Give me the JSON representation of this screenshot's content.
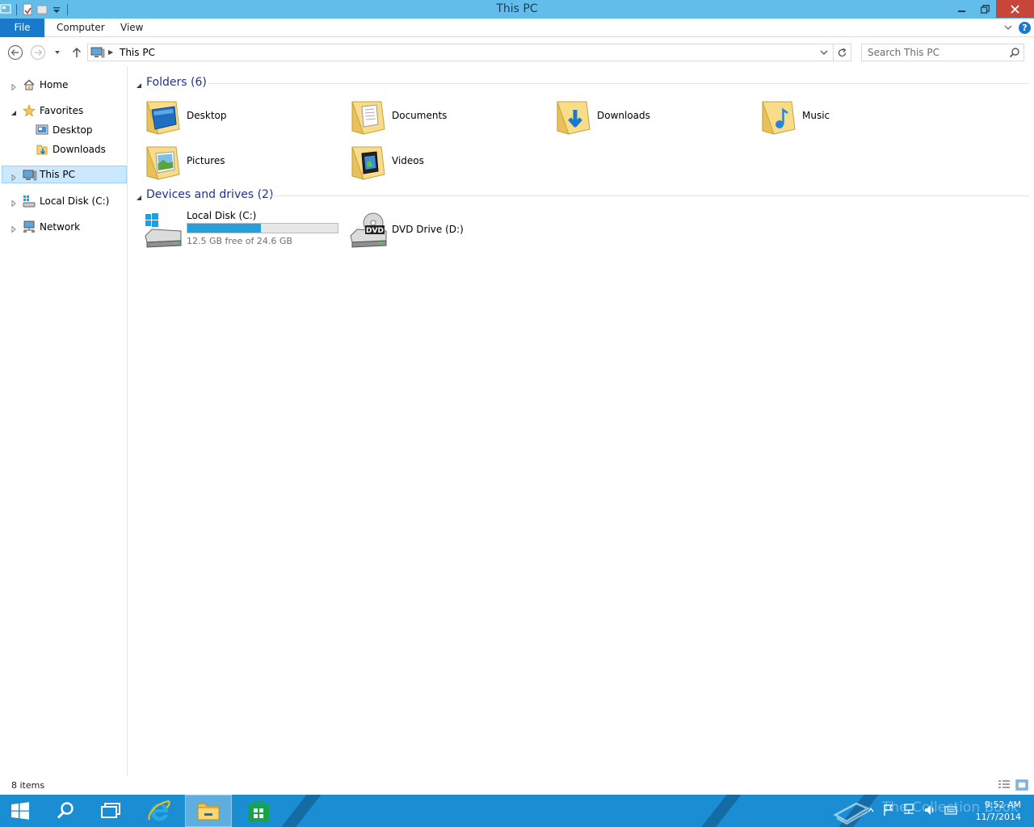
{
  "window": {
    "title": "This PC"
  },
  "ribbon": {
    "tabs": [
      "File",
      "Computer",
      "View"
    ]
  },
  "address": {
    "crumb": "This PC",
    "search_placeholder": "Search This PC"
  },
  "nav": {
    "items": [
      {
        "label": "Home",
        "icon": "home-icon"
      },
      {
        "label": "Favorites",
        "icon": "star-icon"
      },
      {
        "label": "Desktop",
        "icon": "desktop-icon"
      },
      {
        "label": "Downloads",
        "icon": "downloads-icon"
      },
      {
        "label": "This PC",
        "icon": "computer-icon"
      },
      {
        "label": "Local Disk (C:)",
        "icon": "disk-icon"
      },
      {
        "label": "Network",
        "icon": "network-icon"
      }
    ],
    "selected": "This PC"
  },
  "content": {
    "folders_header": "Folders (6)",
    "folders": [
      {
        "label": "Desktop",
        "icon": "desktop-folder-icon"
      },
      {
        "label": "Documents",
        "icon": "documents-folder-icon"
      },
      {
        "label": "Downloads",
        "icon": "downloads-folder-icon"
      },
      {
        "label": "Music",
        "icon": "music-folder-icon"
      },
      {
        "label": "Pictures",
        "icon": "pictures-folder-icon"
      },
      {
        "label": "Videos",
        "icon": "videos-folder-icon"
      }
    ],
    "drives_header": "Devices and drives (2)",
    "drives": [
      {
        "label": "Local Disk (C:)",
        "free_text": "12.5 GB free of 24.6 GB",
        "used_fraction": 0.49,
        "icon": "hard-drive-icon"
      },
      {
        "label": "DVD Drive (D:)",
        "icon": "dvd-drive-icon",
        "badge": "DVD"
      }
    ]
  },
  "status": {
    "items": "8 items"
  },
  "taskbar": {
    "time": "9:52 AM",
    "date": "11/7/2014",
    "watermark": "The Collection Book"
  },
  "colors": {
    "accent": "#1979ca",
    "titlebar": "#62bdea",
    "taskbar": "#1b8ed3",
    "selection": "#cce8ff",
    "header_text": "#1e3287",
    "bar_fill": "#26a0da"
  }
}
